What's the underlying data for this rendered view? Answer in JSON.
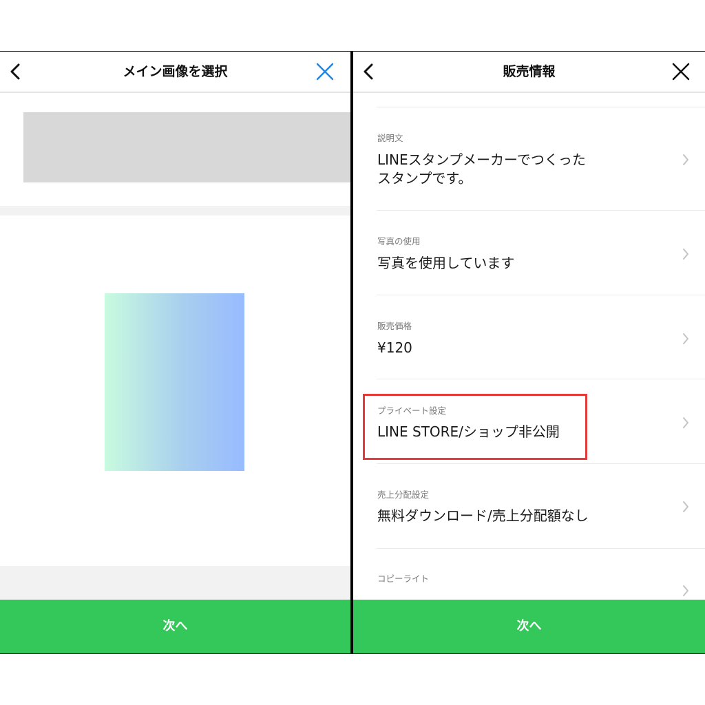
{
  "left_screen": {
    "title": "メイン画像を選択",
    "next_button": "次へ",
    "accent_color": "#1e88e5"
  },
  "right_screen": {
    "title": "販売情報",
    "rows": [
      {
        "label": "説明文",
        "value_line1": "LINEスタンプメーカーでつくった",
        "value_line2": "スタンプです。"
      },
      {
        "label": "写真の使用",
        "value": "写真を使用しています"
      },
      {
        "label": "販売価格",
        "value": "¥120"
      },
      {
        "label": "プライベート設定",
        "value": "LINE STORE/ショップ非公開",
        "highlighted": true
      },
      {
        "label": "売上分配設定",
        "value": "無料ダウンロード/売上分配額なし"
      },
      {
        "label": "コピーライト",
        "value": ""
      }
    ],
    "next_button": "次へ"
  },
  "colors": {
    "next_button": "#34c759",
    "highlight": "#e33a3a"
  }
}
